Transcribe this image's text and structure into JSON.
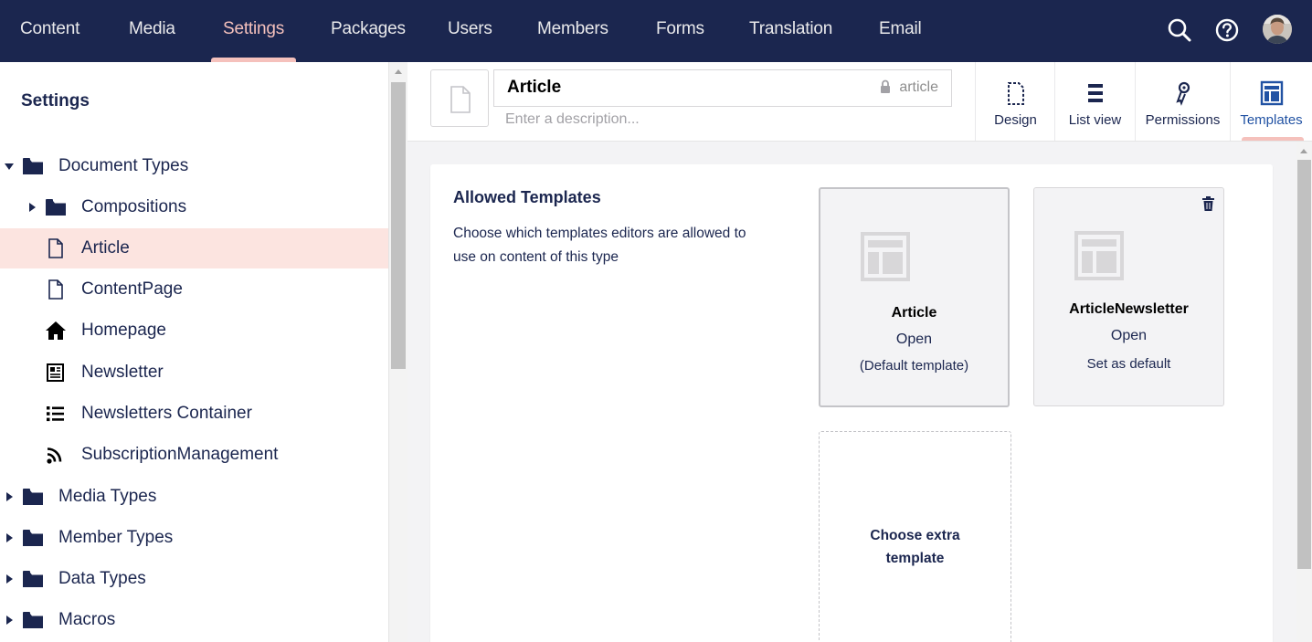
{
  "colors": {
    "topbar": "#1b264f",
    "accent": "#f5c1bc",
    "selected_row": "#fce4e0",
    "active_tab": "#2152a3"
  },
  "topnav": {
    "items": [
      "Content",
      "Media",
      "Settings",
      "Packages",
      "Users",
      "Members",
      "Forms",
      "Translation",
      "Email"
    ],
    "active": "Settings",
    "icons": [
      "search-icon",
      "help-icon",
      "user-avatar"
    ]
  },
  "sidebar": {
    "title": "Settings",
    "tree": [
      {
        "label": "Document Types",
        "icon": "folder-icon",
        "expanded": true
      },
      {
        "label": "Compositions",
        "icon": "folder-icon",
        "expanded": false
      },
      {
        "label": "Article",
        "icon": "document-icon",
        "selected": true
      },
      {
        "label": "ContentPage",
        "icon": "document-icon"
      },
      {
        "label": "Homepage",
        "icon": "home-icon"
      },
      {
        "label": "Newsletter",
        "icon": "newspaper-icon"
      },
      {
        "label": "Newsletters Container",
        "icon": "list-icon"
      },
      {
        "label": "SubscriptionManagement",
        "icon": "rss-icon"
      },
      {
        "label": "Media Types",
        "icon": "folder-icon",
        "expanded": false
      },
      {
        "label": "Member Types",
        "icon": "folder-icon",
        "expanded": false
      },
      {
        "label": "Data Types",
        "icon": "folder-icon",
        "expanded": false
      },
      {
        "label": "Macros",
        "icon": "folder-icon",
        "expanded": false
      }
    ]
  },
  "editor": {
    "name": "Article",
    "alias": "article",
    "description_placeholder": "Enter a description...",
    "tabs": [
      {
        "label": "Design",
        "icon": "design-icon"
      },
      {
        "label": "List view",
        "icon": "list-view-icon"
      },
      {
        "label": "Permissions",
        "icon": "permissions-icon"
      },
      {
        "label": "Templates",
        "icon": "templates-icon",
        "active": true
      }
    ]
  },
  "templates": {
    "title": "Allowed Templates",
    "description": "Choose which templates editors are allowed to use on content of this type",
    "cards": [
      {
        "name": "Article",
        "open_label": "Open",
        "note": "(Default template)"
      },
      {
        "name": "ArticleNewsletter",
        "open_label": "Open",
        "note": "Set as default"
      }
    ],
    "extra_label_line1": "Choose extra",
    "extra_label_line2": "template"
  }
}
